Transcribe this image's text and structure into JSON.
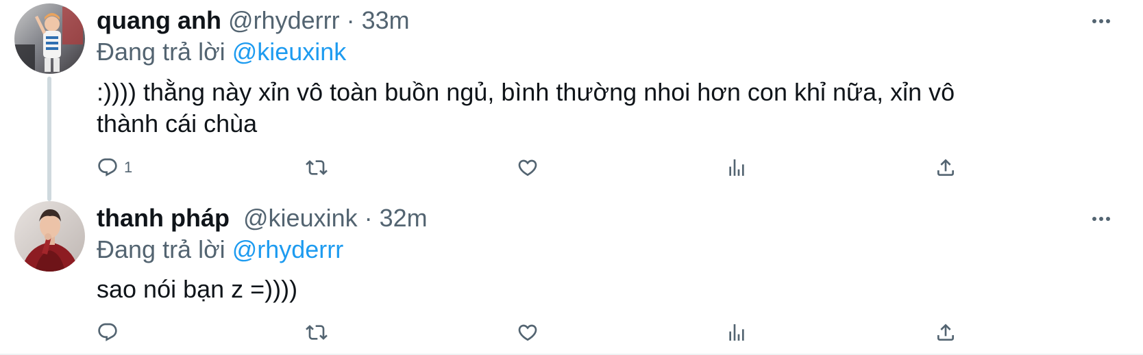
{
  "tweets": [
    {
      "name": "quang anh",
      "handle": "@rhyderrr",
      "separator": " · ",
      "time": "33m",
      "replying_prefix": "Đang trả lời ",
      "replying_to": "@kieuxink",
      "text_line1": ":)))) thằng này xỉn vô toàn buồn ngủ, bình thường nhoi hơn con khỉ nữa, xỉn vô",
      "text_line2": "thành cái chùa",
      "reply_count": "1",
      "avatar_icon": "person-avatar-icon"
    },
    {
      "name": "thanh pháp",
      "handle": "@kieuxink",
      "separator": " · ",
      "time": "32m",
      "replying_prefix": "Đang trả lời ",
      "replying_to": "@rhyderrr",
      "text_line1": "sao nói bạn z =))))",
      "reply_count": "",
      "avatar_icon": "person-avatar-icon"
    }
  ],
  "colors": {
    "text": "#0f1419",
    "secondary": "#536471",
    "link": "#1d9bf0",
    "thread_line": "#cfd9de"
  },
  "icons": [
    "reply-icon",
    "retweet-icon",
    "like-icon",
    "views-icon",
    "share-icon",
    "more-icon"
  ]
}
